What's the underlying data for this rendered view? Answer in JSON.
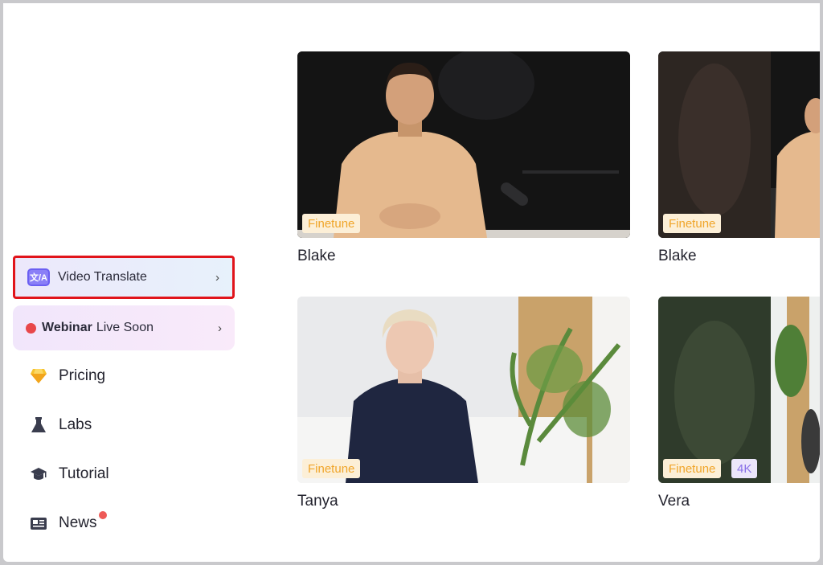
{
  "sidebar": {
    "video_translate": {
      "icon_text": "文/A",
      "label": "Video Translate",
      "chevron": "›"
    },
    "webinar": {
      "bold": "Webinar",
      "label": "Live Soon",
      "chevron": "›"
    },
    "items": [
      {
        "label": "Pricing",
        "icon": "diamond-icon"
      },
      {
        "label": "Labs",
        "icon": "flask-icon"
      },
      {
        "label": "Tutorial",
        "icon": "graduation-cap-icon"
      },
      {
        "label": "News",
        "icon": "newspaper-icon"
      }
    ]
  },
  "avatars": [
    {
      "name": "Blake",
      "badges": [
        "Finetune"
      ]
    },
    {
      "name": "Blake",
      "badges": [
        "Finetune"
      ]
    },
    {
      "name": "Tanya",
      "badges": [
        "Finetune"
      ]
    },
    {
      "name": "Vera",
      "badges": [
        "Finetune",
        "4K"
      ]
    }
  ],
  "colors": {
    "highlight_border": "#e1141b",
    "finetune_badge_text": "#f0a52a",
    "badge_4k_text": "#8a72e8",
    "notification_dot": "#ee5a57"
  }
}
